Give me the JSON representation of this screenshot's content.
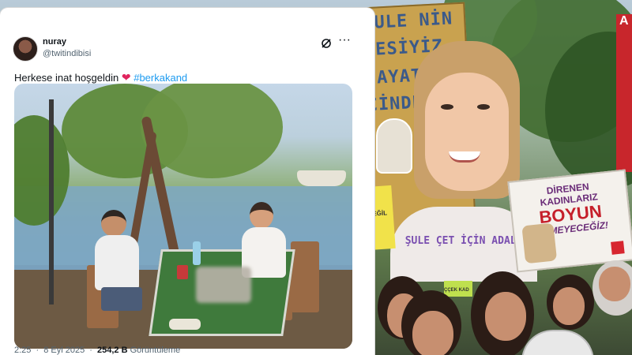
{
  "tweet": {
    "display_name": "nuray",
    "username": "@twitindibisi",
    "text_main": "Herkese inat hoşgeldin ",
    "heart": "❤",
    "hashtag": "#berkakand",
    "meta": {
      "time": "2:25",
      "separator": "·",
      "date": "8 Eyl 2025",
      "views_count": "254,2 B",
      "views_label": "Görüntüleme"
    },
    "icons": {
      "grok": "grok-icon",
      "more": "more-options-icon"
    }
  },
  "protest": {
    "left_sign_lines": [
      "ŞULE NİN",
      "SESİYİZ",
      "HAYAT",
      "CİNDE"
    ],
    "portrait_caption": "ŞULE ÇET İÇİN ADALET",
    "right_sign": {
      "line1": "DİRENEN KADINLARIZ",
      "line2": "BOYUN",
      "line3": "EĞMEYECEĞİZ!"
    },
    "yellow_card_text": "DEĞİL",
    "green_card_text": "ÇÇEK KAD",
    "red_banner_text": "A"
  },
  "colors": {
    "link": "#1d9bf0",
    "heart": "#e0245e",
    "sign_blue": "#3b5a8a",
    "sign_red": "#c51f2a"
  }
}
